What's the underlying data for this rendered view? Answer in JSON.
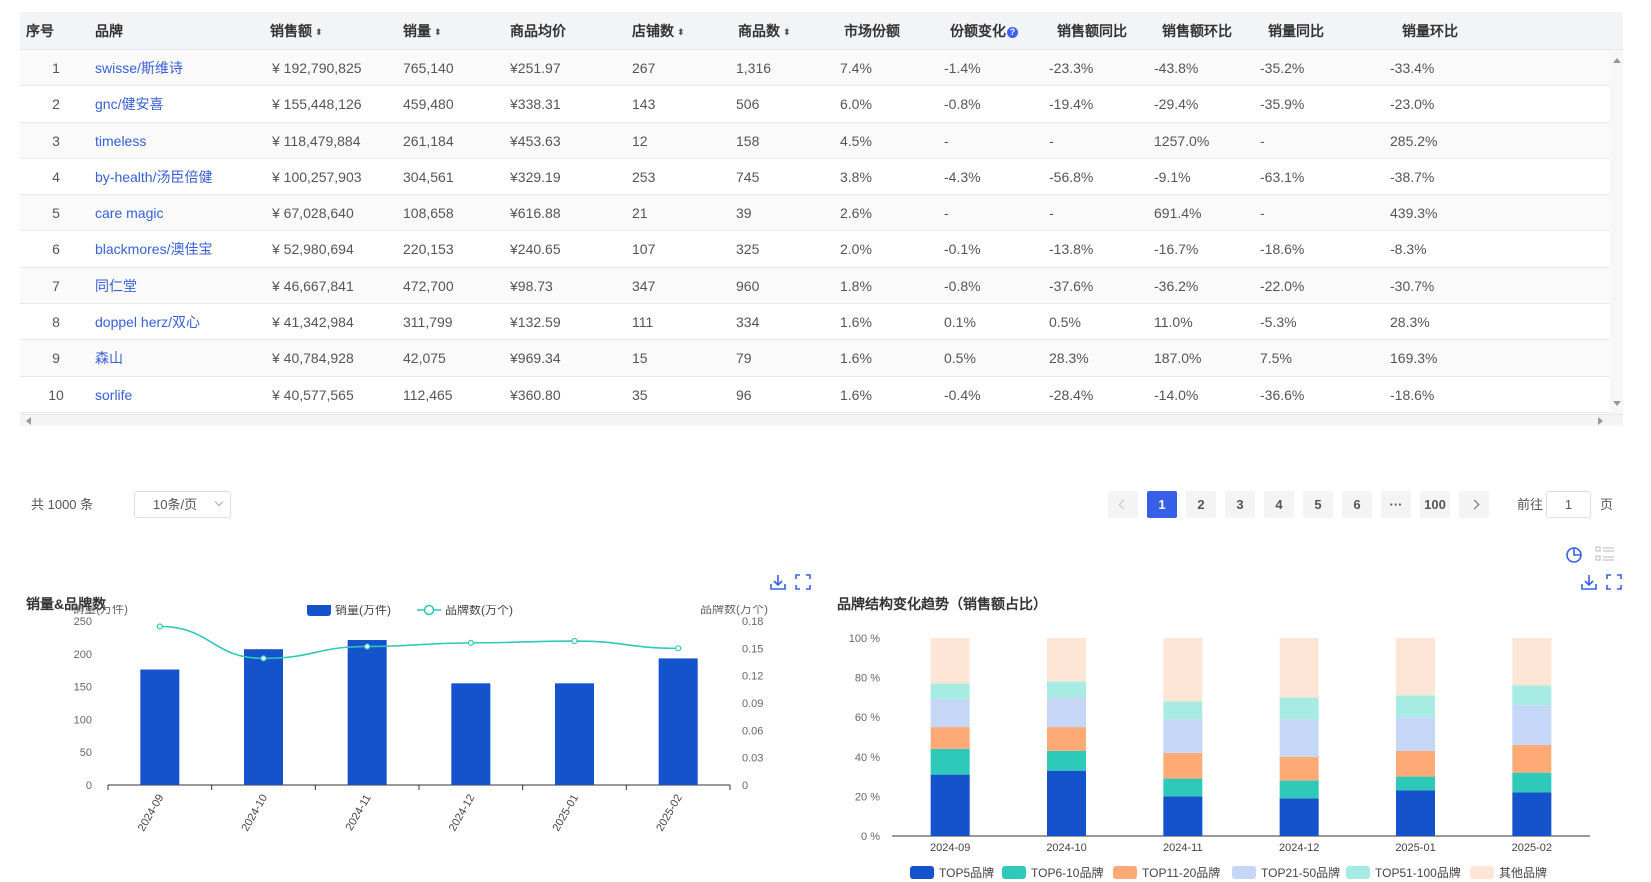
{
  "table": {
    "headers": [
      {
        "label": "序号",
        "sortable": false
      },
      {
        "label": "品牌",
        "sortable": false
      },
      {
        "label": "销售额",
        "sortable": true
      },
      {
        "label": "销量",
        "sortable": true
      },
      {
        "label": "商品均价",
        "sortable": false
      },
      {
        "label": "店铺数",
        "sortable": true
      },
      {
        "label": "商品数",
        "sortable": true
      },
      {
        "label": "市场份额",
        "sortable": false
      },
      {
        "label": "份额变化",
        "sortable": false,
        "help": true
      },
      {
        "label": "销售额同比",
        "sortable": false
      },
      {
        "label": "销售额环比",
        "sortable": false
      },
      {
        "label": "销量同比",
        "sortable": false
      },
      {
        "label": "销量环比",
        "sortable": false
      }
    ],
    "rows": [
      [
        "1",
        "swisse/斯维诗",
        "¥ 192,790,825",
        "765,140",
        "¥251.97",
        "267",
        "1,316",
        "7.4%",
        "-1.4%",
        "-23.3%",
        "-43.8%",
        "-35.2%",
        "-33.4%"
      ],
      [
        "2",
        "gnc/健安喜",
        "¥ 155,448,126",
        "459,480",
        "¥338.31",
        "143",
        "506",
        "6.0%",
        "-0.8%",
        "-19.4%",
        "-29.4%",
        "-35.9%",
        "-23.0%"
      ],
      [
        "3",
        "timeless",
        "¥ 118,479,884",
        "261,184",
        "¥453.63",
        "12",
        "158",
        "4.5%",
        "-",
        "-",
        "1257.0%",
        "-",
        "285.2%"
      ],
      [
        "4",
        "by-health/汤臣倍健",
        "¥ 100,257,903",
        "304,561",
        "¥329.19",
        "253",
        "745",
        "3.8%",
        "-4.3%",
        "-56.8%",
        "-9.1%",
        "-63.1%",
        "-38.7%"
      ],
      [
        "5",
        "care magic",
        "¥ 67,028,640",
        "108,658",
        "¥616.88",
        "21",
        "39",
        "2.6%",
        "-",
        "-",
        "691.4%",
        "-",
        "439.3%"
      ],
      [
        "6",
        "blackmores/澳佳宝",
        "¥ 52,980,694",
        "220,153",
        "¥240.65",
        "107",
        "325",
        "2.0%",
        "-0.1%",
        "-13.8%",
        "-16.7%",
        "-18.6%",
        "-8.3%"
      ],
      [
        "7",
        "同仁堂",
        "¥ 46,667,841",
        "472,700",
        "¥98.73",
        "347",
        "960",
        "1.8%",
        "-0.8%",
        "-37.6%",
        "-36.2%",
        "-22.0%",
        "-30.7%"
      ],
      [
        "8",
        "doppel herz/双心",
        "¥ 41,342,984",
        "311,799",
        "¥132.59",
        "111",
        "334",
        "1.6%",
        "0.1%",
        "0.5%",
        "11.0%",
        "-5.3%",
        "28.3%"
      ],
      [
        "9",
        "森山",
        "¥ 40,784,928",
        "42,075",
        "¥969.34",
        "15",
        "79",
        "1.6%",
        "0.5%",
        "28.3%",
        "187.0%",
        "7.5%",
        "169.3%"
      ],
      [
        "10",
        "sorlife",
        "¥ 40,577,565",
        "112,465",
        "¥360.80",
        "35",
        "96",
        "1.6%",
        "-0.4%",
        "-28.4%",
        "-14.0%",
        "-36.6%",
        "-18.6%"
      ]
    ]
  },
  "pagination": {
    "total_label": "共 1000 条",
    "page_size": "10条/页",
    "pages": [
      "1",
      "2",
      "3",
      "4",
      "5",
      "6"
    ],
    "ellipsis": "···",
    "last_page": "100",
    "current_page": "1",
    "goto_prefix": "前往",
    "goto_value": "1",
    "goto_suffix": "页"
  },
  "charts": {
    "left_title": "销量&品牌数",
    "right_title": "品牌结构变化趋势（销售额占比）"
  },
  "colors": {
    "primary": "#3760e8",
    "bar": "#1553cc",
    "line": "#2ec9b8",
    "link": "#3760d9"
  },
  "chart_data": [
    {
      "type": "bar",
      "title": "销量&品牌数",
      "categories": [
        "2024-09",
        "2024-10",
        "2024-11",
        "2024-12",
        "2025-01",
        "2025-02"
      ],
      "series": [
        {
          "name": "销量(万件)",
          "type": "bar",
          "axis": "left",
          "values": [
            176,
            207,
            221,
            155,
            155,
            193
          ]
        },
        {
          "name": "品牌数(万个)",
          "type": "line",
          "axis": "right",
          "values": [
            0.174,
            0.139,
            0.152,
            0.156,
            0.158,
            0.15
          ]
        }
      ],
      "ylabel": "销量(万件)",
      "y2label": "品牌数(万个)",
      "ylim": [
        0,
        250
      ],
      "yticks": [
        "0",
        "50",
        "100",
        "150",
        "200",
        "250"
      ],
      "y2lim": [
        0,
        0.18
      ],
      "y2ticks": [
        "0",
        "0.03",
        "0.06",
        "0.09",
        "0.12",
        "0.15",
        "0.18"
      ],
      "legend": "top-center"
    },
    {
      "type": "bar",
      "stacked": true,
      "title": "品牌结构变化趋势（销售额占比）",
      "categories": [
        "2024-09",
        "2024-10",
        "2024-11",
        "2024-12",
        "2025-01",
        "2025-02"
      ],
      "series": [
        {
          "name": "TOP5品牌",
          "color": "#1553cc",
          "values": [
            31,
            33,
            20,
            19,
            23,
            22
          ]
        },
        {
          "name": "TOP6-10品牌",
          "color": "#2ec9b8",
          "values": [
            13,
            10,
            9,
            9,
            7,
            10
          ]
        },
        {
          "name": "TOP11-20品牌",
          "color": "#fdaa77",
          "values": [
            11,
            12,
            13,
            12,
            13,
            14
          ]
        },
        {
          "name": "TOP21-50品牌",
          "color": "#c5d6f7",
          "values": [
            14,
            15,
            17,
            19,
            17,
            20
          ]
        },
        {
          "name": "TOP51-100品牌",
          "color": "#a6ece3",
          "values": [
            8,
            8,
            9,
            11,
            11,
            10
          ]
        },
        {
          "name": "其他品牌",
          "color": "#fde6d6",
          "values": [
            23,
            22,
            32,
            30,
            29,
            24
          ]
        }
      ],
      "ylim": [
        0,
        100
      ],
      "yticks": [
        "0 %",
        "20 %",
        "40 %",
        "60 %",
        "80 %",
        "100 %"
      ],
      "legend": "bottom"
    }
  ]
}
